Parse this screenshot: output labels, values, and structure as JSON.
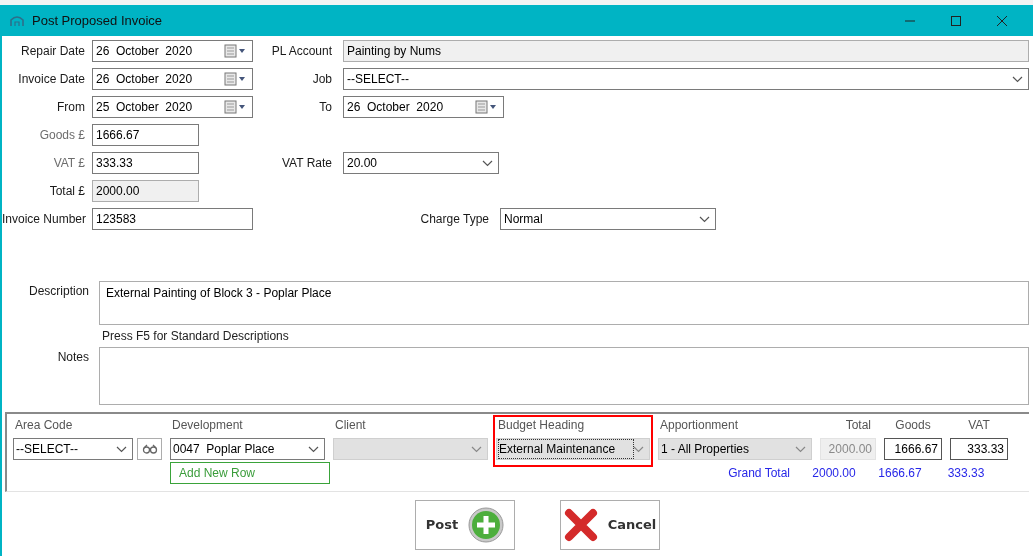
{
  "window": {
    "title": "Post Proposed Invoice"
  },
  "form_rows": [
    {
      "left": {
        "label": "Repair Date",
        "dimmed": false,
        "kind": "date",
        "value": "26  October  2020"
      },
      "right": {
        "label": "PL Account",
        "dimmed": false,
        "kind": "readonly",
        "value": "Painting by Nums"
      }
    },
    {
      "left": {
        "label": "Invoice Date",
        "dimmed": false,
        "kind": "date",
        "value": "26  October  2020"
      },
      "right": {
        "label": "Job",
        "dimmed": false,
        "kind": "select_wide",
        "value": "--SELECT--"
      }
    },
    {
      "left": {
        "label": "From",
        "dimmed": false,
        "kind": "date",
        "value": "25  October  2020"
      },
      "right": {
        "label": "To",
        "dimmed": false,
        "kind": "date",
        "value": "26  October  2020"
      }
    },
    {
      "left": {
        "label": "Goods £",
        "dimmed": true,
        "kind": "text_short",
        "value": "1666.67"
      }
    },
    {
      "left": {
        "label": "VAT £",
        "dimmed": true,
        "kind": "text_short",
        "value": "333.33"
      },
      "right": {
        "label": "VAT Rate",
        "dimmed": false,
        "kind": "select",
        "value": "20.00"
      }
    },
    {
      "left": {
        "label": "Total £",
        "dimmed": false,
        "kind": "readonly_short",
        "value": "2000.00"
      }
    },
    {
      "left": {
        "label": "Invoice Number",
        "dimmed": false,
        "kind": "text",
        "value": "123583"
      },
      "right": {
        "label": "Charge Type",
        "dimmed": false,
        "kind": "select_mid",
        "value": "Normal"
      }
    }
  ],
  "description": {
    "label": "Description",
    "value": "External Painting of Block 3 - Poplar Place",
    "hint": "Press F5 for Standard Descriptions"
  },
  "notes": {
    "label": "Notes"
  },
  "grid": {
    "columns": [
      {
        "label": "Area Code",
        "kind": "select_lookup",
        "value": "--SELECT--",
        "disabled": false,
        "highlighted": false
      },
      {
        "label": "Development",
        "kind": "select",
        "value": "0047  Poplar Place",
        "disabled": false,
        "highlighted": false
      },
      {
        "label": "Client",
        "kind": "select",
        "disabled": true,
        "highlighted": false
      },
      {
        "label": "Budget Heading",
        "kind": "select",
        "value": "External Maintenance",
        "disabled": true,
        "highlighted": true
      },
      {
        "label": "Apportionment",
        "kind": "select",
        "value": "1 - All Properties",
        "disabled": true,
        "highlighted": false
      },
      {
        "label": "Total",
        "kind": "number",
        "value": "2000.00",
        "disabled": true,
        "highlighted": false
      },
      {
        "label": "Goods",
        "kind": "number",
        "value": "1666.67",
        "disabled": false,
        "highlighted": false
      },
      {
        "label": "VAT",
        "kind": "number",
        "value": "333.33",
        "disabled": false,
        "highlighted": false
      }
    ],
    "add_row_button": "Add New Row",
    "grand_total": {
      "label": "Grand Total",
      "values": [
        "2000.00",
        "1666.67",
        "333.33"
      ]
    }
  },
  "buttons": [
    {
      "label": "Post",
      "kind": "post"
    },
    {
      "label": "Cancel",
      "kind": "cancel"
    }
  ]
}
